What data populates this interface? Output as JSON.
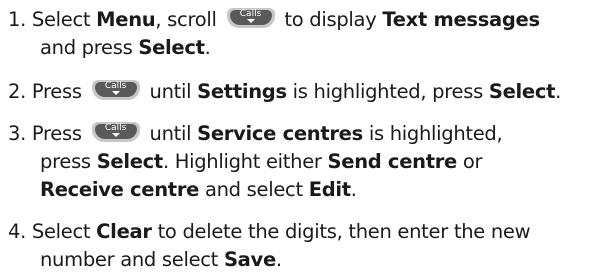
{
  "key_icon": {
    "label": "Calls",
    "icon": "calls-scroll-down-key-icon",
    "color": "#5a5a5a"
  },
  "steps": [
    {
      "num": "1. Select ",
      "menu": "Menu",
      "t1": ", scroll ",
      "t2": " to display ",
      "text_messages": "Text messages",
      "and_press": "and press ",
      "select": "Select",
      "end": "."
    },
    {
      "num": "2. Press ",
      "t1": " until ",
      "settings": "Settings",
      "t2": " is highlighted, press ",
      "select": "Select",
      "end": "."
    },
    {
      "num": "3. Press ",
      "t1": " until ",
      "service_centres": "Service centres",
      "t2": " is highlighted,",
      "press": "press ",
      "select": "Select",
      "t3": ". Highlight either ",
      "send_centre": "Send centre",
      "or": " or",
      "receive_centre": "Receive centre",
      "and_select": " and select ",
      "edit": "Edit",
      "end": "."
    },
    {
      "num": "4. Select ",
      "clear": "Clear",
      "t1": " to delete the digits, then enter the new",
      "t2": "number and select ",
      "save": "Save",
      "end": "."
    }
  ]
}
